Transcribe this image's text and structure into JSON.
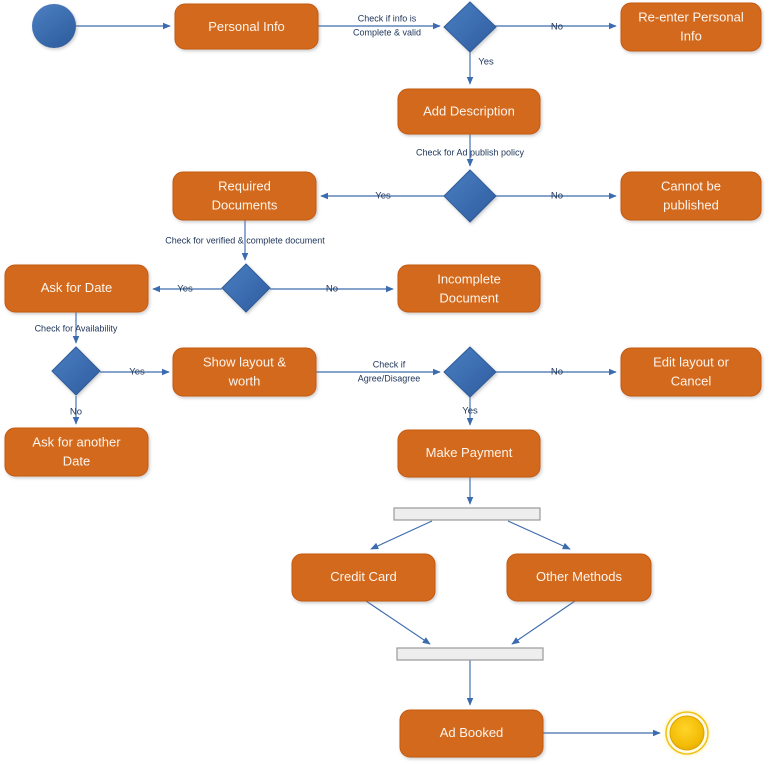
{
  "diagram": {
    "title": "Ad Booking Activity Diagram",
    "colors": {
      "activity_fill": "#d2691e",
      "activity_border": "#c55a11",
      "decision_fill": "#3b6cb0",
      "start_node": "#3b6cb0",
      "end_node": "#f0b800",
      "edge": "#3f6cad",
      "edge_label_text": "#20375b",
      "bar_fill": "#eeeeee",
      "bar_border": "#9a9a9a",
      "background": "#ffffff"
    },
    "nodes": {
      "start": {
        "type": "initial-node",
        "label": ""
      },
      "personal_info": {
        "type": "activity",
        "label": "Personal Info"
      },
      "decision_info": {
        "type": "decision",
        "label": ""
      },
      "reenter_personal_info": {
        "type": "activity",
        "label": "Re-enter Personal Info",
        "line1": "Re-enter Personal",
        "line2": "Info"
      },
      "add_description": {
        "type": "activity",
        "label": "Add Description"
      },
      "decision_policy": {
        "type": "decision",
        "label": ""
      },
      "required_documents": {
        "type": "activity",
        "label": "Required Documents",
        "line1": "Required",
        "line2": "Documents"
      },
      "cannot_be_published": {
        "type": "activity",
        "label": "Cannot be published",
        "line1": "Cannot be",
        "line2": "published"
      },
      "decision_documents": {
        "type": "decision",
        "label": ""
      },
      "ask_for_date": {
        "type": "activity",
        "label": "Ask for Date"
      },
      "incomplete_document": {
        "type": "activity",
        "label": "Incomplete Document",
        "line1": "Incomplete",
        "line2": "Document"
      },
      "decision_availability": {
        "type": "decision",
        "label": ""
      },
      "show_layout_worth": {
        "type": "activity",
        "label": "Show layout & worth",
        "line1": "Show layout &",
        "line2": "worth"
      },
      "ask_for_another_date": {
        "type": "activity",
        "label": "Ask for another Date",
        "line1": "Ask for another",
        "line2": "Date"
      },
      "decision_agree": {
        "type": "decision",
        "label": ""
      },
      "edit_layout_or_cancel": {
        "type": "activity",
        "label": "Edit layout or Cancel",
        "line1": "Edit layout or",
        "line2": "Cancel"
      },
      "make_payment": {
        "type": "activity",
        "label": "Make Payment"
      },
      "fork_bar": {
        "type": "fork",
        "label": ""
      },
      "credit_card": {
        "type": "activity",
        "label": "Credit Card"
      },
      "other_methods": {
        "type": "activity",
        "label": "Other Methods"
      },
      "join_bar": {
        "type": "join",
        "label": ""
      },
      "ad_booked": {
        "type": "activity",
        "label": "Ad Booked"
      },
      "end": {
        "type": "final-node",
        "label": ""
      }
    },
    "edge_labels": {
      "check_info_line1": "Check if info is",
      "check_info_line2": "Complete & valid",
      "info_no": "No",
      "info_yes": "Yes",
      "check_publish_policy": "Check for Ad publish policy",
      "policy_yes": "Yes",
      "policy_no": "No",
      "check_verified_document": "Check for verified & complete document",
      "documents_yes": "Yes",
      "documents_no": "No",
      "check_availability": "Check for Availability",
      "availability_yes": "Yes",
      "availability_no": "No",
      "check_agree_line1": "Check if",
      "check_agree_line2": "Agree/Disagree",
      "agree_no": "No",
      "agree_yes": "Yes"
    }
  }
}
